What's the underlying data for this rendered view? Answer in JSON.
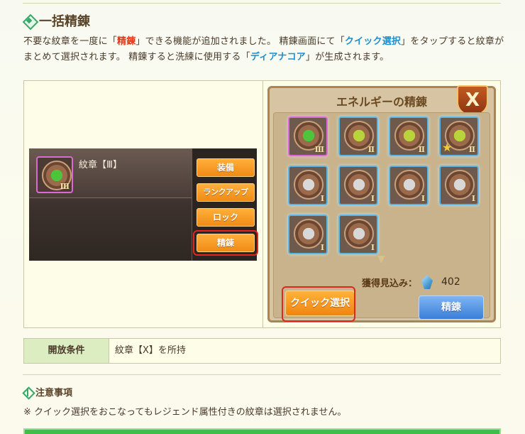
{
  "section": {
    "title": "一括精錬",
    "desc_prefix": "不要な紋章を一度に「",
    "desc_hl1": "精錬",
    "desc_mid1": "」できる機能が追加されました。 精錬画面にて「",
    "desc_hl2": "クイック選択",
    "desc_mid2": "」をタップすると紋章がまとめて選択されます。 精錬すると洗練に使用する「",
    "desc_hl3": "ディアナコア",
    "desc_suffix": "」が生成されます。"
  },
  "item_panel": {
    "name": "紋章【Ⅲ】",
    "rank": "Ⅲ",
    "buttons": [
      "装備",
      "ランクアップ",
      "ロック",
      "精錬"
    ]
  },
  "refine_panel": {
    "title": "エネルギーの精錬",
    "close_label": "X",
    "slots": [
      {
        "rank": "Ⅲ",
        "color": "green",
        "legend": true,
        "star": false
      },
      {
        "rank": "Ⅱ",
        "color": "lime",
        "legend": false,
        "star": false
      },
      {
        "rank": "Ⅱ",
        "color": "lime",
        "legend": false,
        "star": false
      },
      {
        "rank": "Ⅱ",
        "color": "lime",
        "legend": false,
        "star": true
      },
      {
        "rank": "Ⅰ",
        "color": "silver",
        "legend": false,
        "star": false
      },
      {
        "rank": "Ⅰ",
        "color": "silver",
        "legend": false,
        "star": false
      },
      {
        "rank": "Ⅰ",
        "color": "silver",
        "legend": false,
        "star": false
      },
      {
        "rank": "Ⅰ",
        "color": "silver",
        "legend": false,
        "star": false
      },
      {
        "rank": "Ⅰ",
        "color": "silver",
        "legend": false,
        "star": false
      },
      {
        "rank": "Ⅰ",
        "color": "silver",
        "legend": false,
        "star": false
      }
    ],
    "gain_label": "獲得見込み：",
    "gain_value": "402",
    "quick_select_label": "クイック選択",
    "refine_label": "精錬"
  },
  "condition": {
    "label": "開放条件",
    "value": "紋章【X】を所持"
  },
  "notes": {
    "title": "注意事項",
    "text": "※ クイック選択をおこなってもレジェンド属性付きの紋章は選択されません。"
  },
  "colors": {
    "accent_green": "#3aa86a",
    "highlight_red": "#e03a1a",
    "highlight_blue": "#1b8fd1",
    "orange_button": "#f08a16",
    "blue_button": "#3a7fd8"
  }
}
